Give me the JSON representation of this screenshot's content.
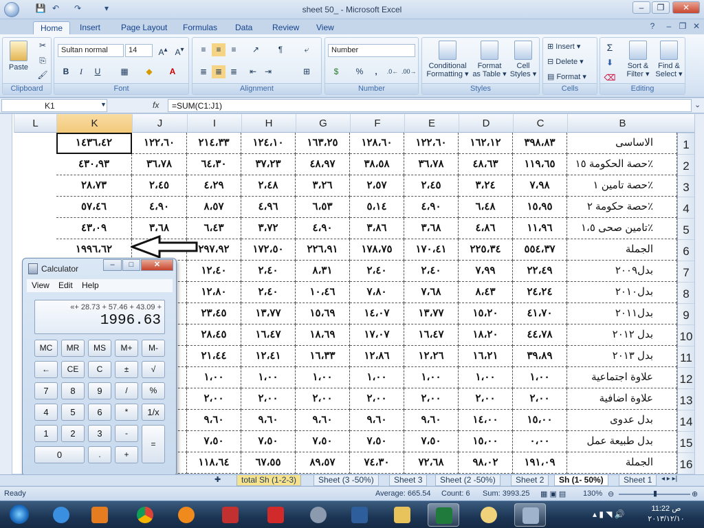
{
  "window": {
    "title": "sheet 50_  -  Microsoft Excel"
  },
  "ribbon": {
    "tabs": [
      "Home",
      "Insert",
      "Page Layout",
      "Formulas",
      "Data",
      "Review",
      "View"
    ],
    "clipboard": {
      "paste": "Paste",
      "label": "Clipboard"
    },
    "font": {
      "name": "Sultan normal",
      "size": "14",
      "label": "Font"
    },
    "alignment": {
      "label": "Alignment"
    },
    "number": {
      "format": "Number",
      "label": "Number"
    },
    "styles": {
      "cond": "Conditional",
      "cond2": "Formatting",
      "fmt": "Format",
      "fmt2": "as Table",
      "cell": "Cell",
      "cell2": "Styles",
      "label": "Styles"
    },
    "cells": {
      "insert": "Insert",
      "delete": "Delete",
      "format": "Format",
      "label": "Cells"
    },
    "editing": {
      "sort": "Sort &",
      "sort2": "Filter",
      "find": "Find &",
      "find2": "Select",
      "label": "Editing"
    }
  },
  "formula_bar": {
    "name_box": "K1",
    "fx": "fx",
    "formula": "=SUM(C1:J1)"
  },
  "columns": [
    "L",
    "K",
    "J",
    "I",
    "H",
    "G",
    "F",
    "E",
    "D",
    "C",
    "B"
  ],
  "rows": [
    {
      "n": "1",
      "B": "الاساسى",
      "C": "٣٩٨،٨٣",
      "D": "١٦٢،١٢",
      "E": "١٢٢،٦٠",
      "F": "١٢٨،٦٠",
      "G": "١٦٣،٢٥",
      "H": "١٢٤،١٠",
      "I": "٢١٤،٣٣",
      "J": "١٢٢،٦٠",
      "K": "١٤٣٦،٤٢"
    },
    {
      "n": "2",
      "B": "حصة الحكومة ١٥٪",
      "C": "١١٩،٦٥",
      "D": "٤٨،٦٣",
      "E": "٣٦،٧٨",
      "F": "٣٨،٥٨",
      "G": "٤٨،٩٧",
      "H": "٣٧،٢٣",
      "I": "٦٤،٣٠",
      "J": "٣٦،٧٨",
      "K": "٤٣٠،٩٣"
    },
    {
      "n": "3",
      "B": "حصة تامين ١٪",
      "C": "٧،٩٨",
      "D": "٣،٢٤",
      "E": "٢،٤٥",
      "F": "٢،٥٧",
      "G": "٣،٢٦",
      "H": "٢،٤٨",
      "I": "٤،٢٩",
      "J": "٢،٤٥",
      "K": "٢٨،٧٣"
    },
    {
      "n": "4",
      "B": "حصة حكومة ٢٪",
      "C": "١٥،٩٥",
      "D": "٦،٤٨",
      "E": "٤،٩٠",
      "F": "٥،١٤",
      "G": "٦،٥٣",
      "H": "٤،٩٦",
      "I": "٨،٥٧",
      "J": "٤،٩٠",
      "K": "٥٧،٤٦"
    },
    {
      "n": "5",
      "B": "تامين صحى ١،٥٪",
      "C": "١١،٩٦",
      "D": "٤،٨٦",
      "E": "٣،٦٨",
      "F": "٣،٨٦",
      "G": "٤،٩٠",
      "H": "٣،٧٢",
      "I": "٦،٤٣",
      "J": "٣،٦٨",
      "K": "٤٣،٠٩"
    },
    {
      "n": "6",
      "B": "الجملة",
      "C": "٥٥٤،٣٧",
      "D": "٢٢٥،٣٤",
      "E": "١٧٠،٤١",
      "F": "١٧٨،٧٥",
      "G": "٢٢٦،٩١",
      "H": "١٧٢،٥٠",
      "I": "٢٩٧،٩٢",
      "J": "",
      "K": "١٩٩٦،٦٢"
    },
    {
      "n": "7",
      "B": "بدل٢٠٠٩",
      "C": "٢٢،٤٩",
      "D": "٧،٩٩",
      "E": "٢،٤٠",
      "F": "٢،٤٠",
      "G": "٨،٣١",
      "H": "٢،٤٠",
      "I": "١٢،٤٠",
      "J": "",
      "K": ""
    },
    {
      "n": "8",
      "B": "بدل٢٠١٠",
      "C": "٢٤،٢٤",
      "D": "٨،٤٣",
      "E": "٧،٦٨",
      "F": "٧،٨٠",
      "G": "١٠،٤٦",
      "H": "٢،٤٠",
      "I": "١٢،٨٠",
      "J": "",
      "K": ""
    },
    {
      "n": "9",
      "B": "بدل٢٠١١",
      "C": "٤١،٧٠",
      "D": "١٥،٢٠",
      "E": "١٣،٧٧",
      "F": "١٤،٠٧",
      "G": "١٥،٦٩",
      "H": "١٣،٧٧",
      "I": "٢٣،٤٥",
      "J": "",
      "K": ""
    },
    {
      "n": "10",
      "B": "بدل ٢٠١٢",
      "C": "٤٤،٧٨",
      "D": "١٨،٢٠",
      "E": "١٦،٤٧",
      "F": "١٧،٠٧",
      "G": "١٨،٦٩",
      "H": "١٦،٤٧",
      "I": "٢٨،٤٥",
      "J": "",
      "K": ""
    },
    {
      "n": "11",
      "B": "بدل ٢٠١٣",
      "C": "٣٩،٨٩",
      "D": "١٦،٢١",
      "E": "١٢،٢٦",
      "F": "١٢،٨٦",
      "G": "١٦،٣٣",
      "H": "١٢،٤١",
      "I": "٢١،٤٤",
      "J": "",
      "K": ""
    },
    {
      "n": "12",
      "B": "علاوة اجتماعية",
      "C": "١،٠٠",
      "D": "١،٠٠",
      "E": "١،٠٠",
      "F": "١،٠٠",
      "G": "١،٠٠",
      "H": "١،٠٠",
      "I": "١،٠٠",
      "J": "",
      "K": ""
    },
    {
      "n": "13",
      "B": "علاوة اضافية",
      "C": "٢،٠٠",
      "D": "٢،٠٠",
      "E": "٢،٠٠",
      "F": "٢،٠٠",
      "G": "٢،٠٠",
      "H": "٢،٠٠",
      "I": "٢،٠٠",
      "J": "",
      "K": ""
    },
    {
      "n": "14",
      "B": "بدل عدوى",
      "C": "١٥،٠٠",
      "D": "١٤،٠٠",
      "E": "٩،٦٠",
      "F": "٩،٦٠",
      "G": "٩،٦٠",
      "H": "٩،٦٠",
      "I": "٩،٦٠",
      "J": "",
      "K": ""
    },
    {
      "n": "15",
      "B": "بدل طبيعة عمل",
      "C": "٠،٠٠",
      "D": "١٥،٠٠",
      "E": "٧،٥٠",
      "F": "٧،٥٠",
      "G": "٧،٥٠",
      "H": "٧،٥٠",
      "I": "٧،٥٠",
      "J": "",
      "K": ""
    },
    {
      "n": "16",
      "B": "الجملة",
      "C": "١٩١،٠٩",
      "D": "٩٨،٠٢",
      "E": "٧٢،٦٨",
      "F": "٧٤،٣٠",
      "G": "٨٩،٥٧",
      "H": "٦٧،٥٥",
      "I": "١١٨،٦٤",
      "J": "",
      "K": ""
    }
  ],
  "calculator": {
    "title": "Calculator",
    "menu": [
      "View",
      "Edit",
      "Help"
    ],
    "expression": "«+ 28.73 + 57.46 + 43.09 +",
    "result": "1996.63",
    "keys": [
      [
        "MC",
        "MR",
        "MS",
        "M+",
        "M-"
      ],
      [
        "←",
        "CE",
        "C",
        "±",
        "√"
      ],
      [
        "7",
        "8",
        "9",
        "/",
        "%"
      ],
      [
        "4",
        "5",
        "6",
        "*",
        "1/x"
      ],
      [
        "1",
        "2",
        "3",
        "-",
        "="
      ],
      [
        "0",
        ".",
        "+"
      ]
    ]
  },
  "sheets": [
    "total Sh (1-2-3)",
    "Sheet (3 -50%)",
    "Sheet 3",
    "Sheet (2 -50%)",
    "Sheet 2",
    "Sh (1- 50%)",
    "Sheet 1"
  ],
  "active_sheet": "Sh (1- 50%)",
  "status": {
    "mode": "Ready",
    "average": "Average: 665.54",
    "count": "Count: 6",
    "sum": "Sum: 3993.25",
    "zoom": "130%"
  },
  "clock": {
    "time": "11:22 ص",
    "date": "٢٠١٣/١٢/١٠"
  }
}
